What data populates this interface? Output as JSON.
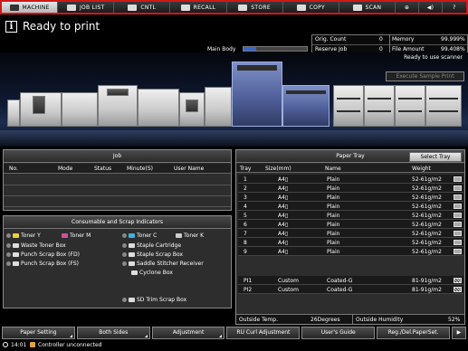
{
  "top_tabs": [
    {
      "label": "MACHINE",
      "icon": "machine-icon",
      "active": true
    },
    {
      "label": "JOB LIST",
      "icon": "job-list-icon"
    },
    {
      "label": "CNTL",
      "icon": "control-icon"
    },
    {
      "label": "RECALL",
      "icon": "recall-icon"
    },
    {
      "label": "STORE",
      "icon": "store-icon"
    },
    {
      "label": "COPY",
      "icon": "copy-icon"
    },
    {
      "label": "SCAN",
      "icon": "scan-icon"
    }
  ],
  "status": {
    "ready_text": "Ready to print",
    "main_body_label": "Main Body",
    "main_body_fill": 0.2,
    "scanner_status": "Ready to use scanner",
    "execute_sample_label": "Execute Sample Print"
  },
  "counters": {
    "orig_count_label": "Orig. Count",
    "orig_count_value": "0",
    "reserve_job_label": "Reserve Job",
    "reserve_job_value": "0",
    "memory_label": "Memory",
    "memory_value": "99.999%",
    "file_amount_label": "File Amount",
    "file_amount_value": "99.408%"
  },
  "job": {
    "title": "Job",
    "columns": [
      "No.",
      "Mode",
      "Status",
      "Minute(S)",
      "User Name"
    ]
  },
  "consumables": {
    "title": "Consumable and Scrap Indicators",
    "items": [
      "Toner Y",
      "Toner M",
      "Toner C",
      "Toner K",
      "Waste Toner Box",
      "Staple Cartridge",
      "Punch Scrap Box (FD)",
      "Staple Scrap Box",
      "Punch Scrap Box (FS)",
      "Saddle Stitcher Receiver",
      "Cyclone Box",
      "SD Trim Scrap Box"
    ]
  },
  "paper_tray": {
    "title": "Paper Tray",
    "select_label": "Select Tray",
    "columns": [
      "Tray",
      "Size(mm)",
      "Name",
      "Weight"
    ],
    "rows": [
      {
        "tray": "1",
        "size": "A4▯",
        "name": "Plain",
        "weight": "52-61g/m2"
      },
      {
        "tray": "2",
        "size": "A4▯",
        "name": "Plain",
        "weight": "52-61g/m2"
      },
      {
        "tray": "3",
        "size": "A4▯",
        "name": "Plain",
        "weight": "52-61g/m2"
      },
      {
        "tray": "4",
        "size": "A4▯",
        "name": "Plain",
        "weight": "52-61g/m2"
      },
      {
        "tray": "5",
        "size": "A4▯",
        "name": "Plain",
        "weight": "52-61g/m2"
      },
      {
        "tray": "6",
        "size": "A4▯",
        "name": "Plain",
        "weight": "52-61g/m2"
      },
      {
        "tray": "7",
        "size": "A4▯",
        "name": "Plain",
        "weight": "52-61g/m2"
      },
      {
        "tray": "8",
        "size": "A4▯",
        "name": "Plain",
        "weight": "52-61g/m2"
      },
      {
        "tray": "9",
        "size": "A4▯",
        "name": "Plain",
        "weight": "52-61g/m2"
      }
    ],
    "pi_rows": [
      {
        "tray": "PI1",
        "size": "Custom",
        "name": "Coated-G",
        "weight": "81-91g/m2"
      },
      {
        "tray": "PI2",
        "size": "Custom",
        "name": "Coated-G",
        "weight": "81-91g/m2"
      }
    ],
    "outside_temp_label": "Outside Temp.",
    "outside_temp_value": "26Degrees",
    "outside_humidity_label": "Outside Humidity",
    "outside_humidity_value": "52%"
  },
  "bottom_buttons": [
    "Paper Setting",
    "Both Sides",
    "Adjustment",
    "RU Curl Adjustment",
    "User's Guide",
    "Reg./Del.PaperSet."
  ],
  "footer": {
    "time": "14:01",
    "controller_status": "Controller unconnected"
  },
  "colors": {
    "highlight_border": "#d01818",
    "main_body_bar": "#3a68c8",
    "machine_blue": "#4d5c96"
  }
}
